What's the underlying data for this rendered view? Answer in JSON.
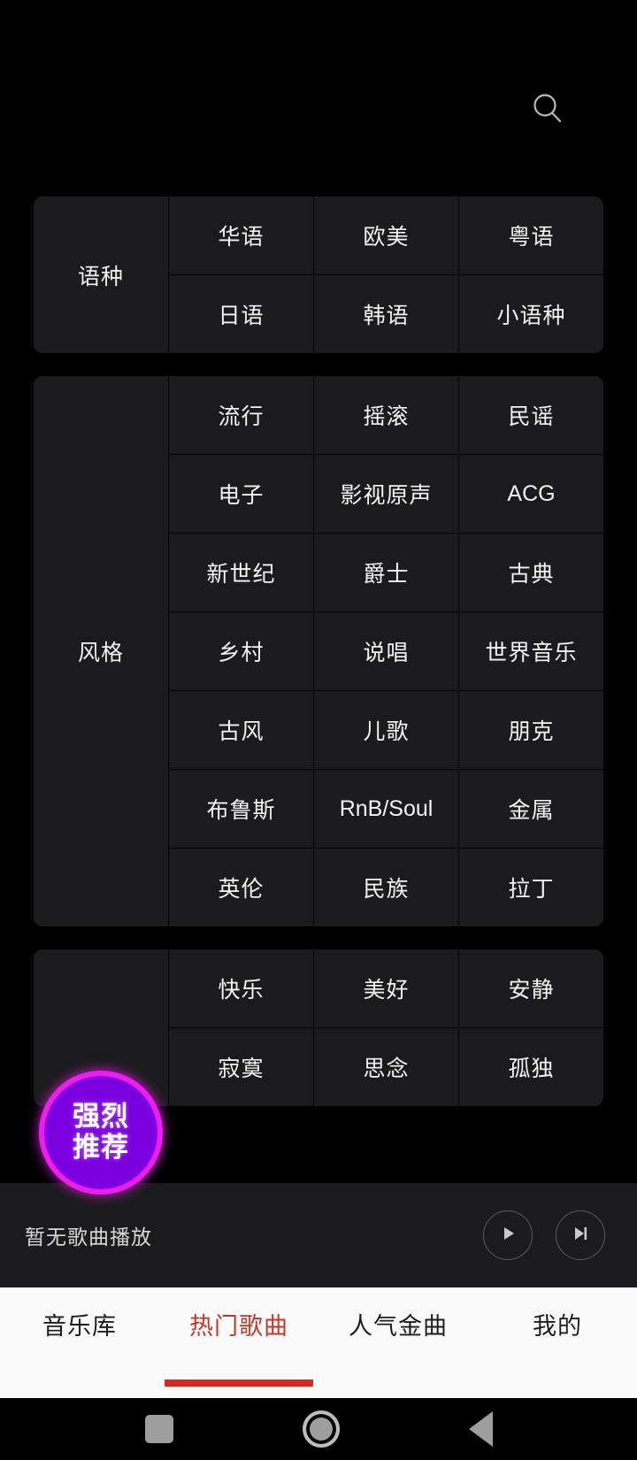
{
  "topbar": {
    "search_icon": "search-icon"
  },
  "sections": [
    {
      "label": "语种",
      "items": [
        "华语",
        "欧美",
        "粤语",
        "日语",
        "韩语",
        "小语种"
      ]
    },
    {
      "label": "风格",
      "items": [
        "流行",
        "摇滚",
        "民谣",
        "电子",
        "影视原声",
        "ACG",
        "新世纪",
        "爵士",
        "古典",
        "乡村",
        "说唱",
        "世界音乐",
        "古风",
        "儿歌",
        "朋克",
        "布鲁斯",
        "RnB/Soul",
        "金属",
        "英伦",
        "民族",
        "拉丁"
      ]
    },
    {
      "label": "",
      "items": [
        "快乐",
        "美好",
        "安静",
        "寂寞",
        "思念",
        "孤独"
      ]
    }
  ],
  "badge": {
    "line1": "强烈",
    "line2": "推荐",
    "ring_color": "#ef1cef",
    "fill_color": "#7b00e0"
  },
  "player": {
    "title": "暂无歌曲播放",
    "play_icon": "play-icon",
    "next_icon": "next-track-icon"
  },
  "tabbar": {
    "accent_color": "#c0392b",
    "tabs": [
      {
        "label": "音乐库",
        "active": false
      },
      {
        "label": "热门歌曲",
        "active": true
      },
      {
        "label": "人气金曲",
        "active": false
      },
      {
        "label": "我的",
        "active": false
      }
    ]
  },
  "navbar": {
    "recents": "recents-square-icon",
    "home": "home-circle-icon",
    "back": "back-triangle-icon"
  }
}
